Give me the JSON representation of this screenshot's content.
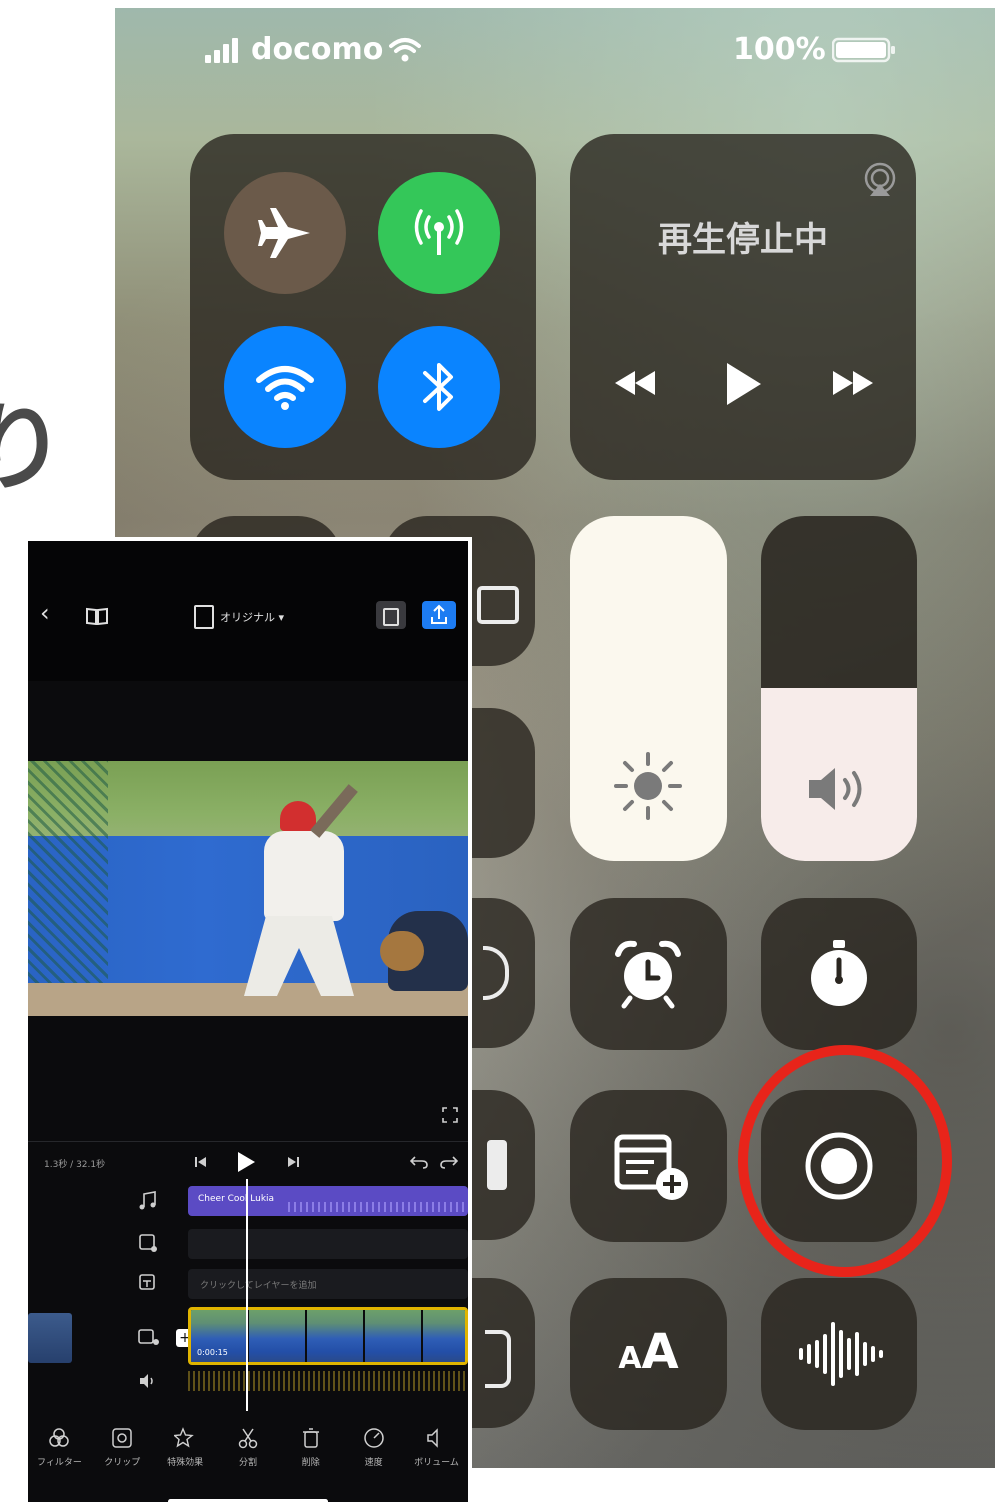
{
  "background": {
    "partial_heading_char": "り"
  },
  "control_center": {
    "status_bar": {
      "carrier": "docomo",
      "battery": "100%"
    },
    "connectivity": {
      "airplane": "airplane-icon",
      "cellular": "antenna-icon",
      "wifi": "wifi-icon",
      "bluetooth": "bluetooth-icon"
    },
    "now_playing": {
      "status_text": "再生停止中"
    },
    "font_size_label": "AA",
    "brightness_level": 1.0,
    "volume_level": 0.5,
    "colors": {
      "green": "#34c759",
      "blue": "#0a84ff",
      "highlight": "#e8241a"
    }
  },
  "editor_app": {
    "header": {
      "aspect_label": "オリジナル ▾"
    },
    "timeline": {
      "time_readout": "1.3秒 / 32.1秒",
      "audio_clip_label": "Cheer Cool Lukia",
      "text_layer_placeholder": "クリックしてレイヤーを追加",
      "video_clip_label": "0:00:15"
    },
    "toolbar": [
      {
        "icon": "filter-icon",
        "label": "フィルター"
      },
      {
        "icon": "clip-icon",
        "label": "クリップ"
      },
      {
        "icon": "effects-icon",
        "label": "特殊効果"
      },
      {
        "icon": "cut-icon",
        "label": "分割"
      },
      {
        "icon": "delete-icon",
        "label": "削除"
      },
      {
        "icon": "speed-icon",
        "label": "速度"
      },
      {
        "icon": "volume-icon",
        "label": "ボリューム"
      }
    ]
  }
}
